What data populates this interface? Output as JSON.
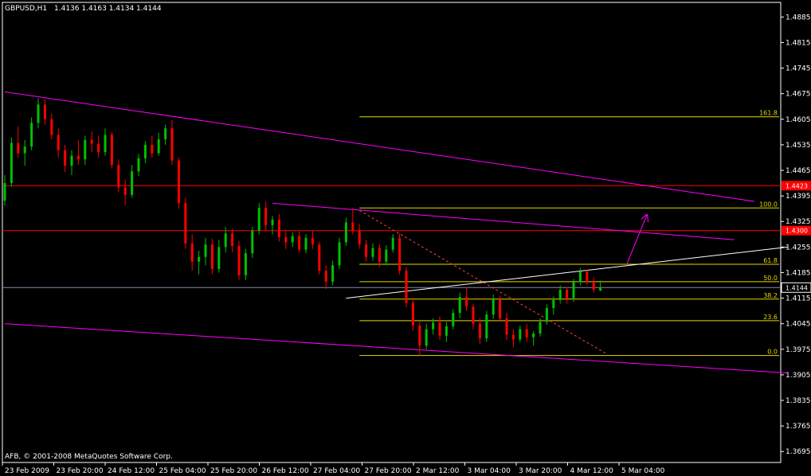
{
  "header": {
    "symbol": "GBPUSD,H1",
    "ohlc": "1.4136 1.4163 1.4134 1.4144"
  },
  "copyright": "AFB, © 2001-2008 MetaQuotes Software Corp.",
  "colors": {
    "background": "#000000",
    "bull_candle": "#00c000",
    "bear_candle": "#ff0000",
    "channel_line": "#ff00ff",
    "fib_line": "#e6d800",
    "level_line": "#ff0000",
    "trend_line": "#ffffff",
    "dashed_trend": "#ff4040",
    "grid_axis": "#ffffff"
  },
  "chart_data": {
    "type": "candlestick",
    "timeframe": "H1",
    "ylim": [
      1.3665,
      1.4925
    ],
    "y_ticks": [
      "1.4885",
      "1.4815",
      "1.4745",
      "1.4675",
      "1.4605",
      "1.4535",
      "1.4465",
      "1.4395",
      "1.4325",
      "1.4255",
      "1.4185",
      "1.4115",
      "1.4045",
      "1.3975",
      "1.3905",
      "1.3835",
      "1.3765",
      "1.3695"
    ],
    "x_ticks": [
      "23 Feb 2009",
      "23 Feb 20:00",
      "24 Feb 12:00",
      "25 Feb 04:00",
      "25 Feb 20:00",
      "26 Feb 12:00",
      "27 Feb 04:00",
      "27 Feb 20:00",
      "2 Mar 12:00",
      "3 Mar 04:00",
      "3 Mar 20:00",
      "4 Mar 12:00",
      "5 Mar 04:00"
    ],
    "current_price": "1.4144",
    "horizontal_levels": [
      {
        "price": "1.4423"
      },
      {
        "price": "1.4300"
      },
      {
        "price": "1.4144"
      }
    ],
    "fibonacci": {
      "price_low": 1.3958,
      "price_high": 1.4362,
      "levels": [
        {
          "label": "161.8",
          "ratio": 1.618
        },
        {
          "label": "100.0",
          "ratio": 1.0
        },
        {
          "label": "61.8",
          "ratio": 0.618
        },
        {
          "label": "50.0",
          "ratio": 0.5
        },
        {
          "label": "38.2",
          "ratio": 0.382
        },
        {
          "label": "23.6",
          "ratio": 0.236
        },
        {
          "label": "0.0",
          "ratio": 0.0
        }
      ]
    },
    "trend_lines": [
      {
        "kind": "channel",
        "from": [
          0,
          1.468
        ],
        "to": [
          112,
          1.438
        ]
      },
      {
        "kind": "channel",
        "from": [
          0,
          1.4045
        ],
        "to": [
          117,
          1.391
        ]
      },
      {
        "kind": "channel",
        "from": [
          40,
          1.4375
        ],
        "to": [
          109,
          1.4275
        ]
      },
      {
        "kind": "support",
        "from": [
          51,
          1.4115
        ],
        "to": [
          117,
          1.4255
        ]
      },
      {
        "kind": "dashed",
        "from": [
          53,
          1.4355
        ],
        "to": [
          90,
          1.3962
        ]
      },
      {
        "kind": "arrow",
        "from": [
          93,
          1.421
        ],
        "to": [
          96,
          1.4345
        ]
      }
    ],
    "candles": [
      [
        1.4382,
        1.4452,
        1.4368,
        1.443
      ],
      [
        1.443,
        1.4555,
        1.442,
        1.454
      ],
      [
        1.454,
        1.4585,
        1.45,
        1.4512
      ],
      [
        1.4512,
        1.4548,
        1.4478,
        1.453
      ],
      [
        1.453,
        1.461,
        1.452,
        1.4595
      ],
      [
        1.4595,
        1.4662,
        1.458,
        1.4645
      ],
      [
        1.4645,
        1.466,
        1.459,
        1.4605
      ],
      [
        1.4605,
        1.462,
        1.455,
        1.4562
      ],
      [
        1.4562,
        1.458,
        1.45,
        1.452
      ],
      [
        1.452,
        1.4535,
        1.446,
        1.4478
      ],
      [
        1.4478,
        1.452,
        1.4452,
        1.4505
      ],
      [
        1.4505,
        1.4548,
        1.448,
        1.4495
      ],
      [
        1.4495,
        1.456,
        1.448,
        1.4548
      ],
      [
        1.4548,
        1.4572,
        1.4515,
        1.4538
      ],
      [
        1.4538,
        1.456,
        1.45,
        1.4515
      ],
      [
        1.4515,
        1.458,
        1.4505,
        1.4562
      ],
      [
        1.4562,
        1.457,
        1.447,
        1.448
      ],
      [
        1.448,
        1.4495,
        1.4405,
        1.4418
      ],
      [
        1.4418,
        1.444,
        1.437,
        1.4398
      ],
      [
        1.4398,
        1.448,
        1.439,
        1.4462
      ],
      [
        1.4462,
        1.451,
        1.445,
        1.4498
      ],
      [
        1.4498,
        1.4545,
        1.4485,
        1.4535
      ],
      [
        1.4535,
        1.456,
        1.45,
        1.4512
      ],
      [
        1.4512,
        1.4568,
        1.4505,
        1.455
      ],
      [
        1.455,
        1.459,
        1.4535,
        1.458
      ],
      [
        1.458,
        1.4602,
        1.448,
        1.4492
      ],
      [
        1.4492,
        1.45,
        1.436,
        1.4375
      ],
      [
        1.4375,
        1.439,
        1.425,
        1.4265
      ],
      [
        1.4265,
        1.429,
        1.419,
        1.4215
      ],
      [
        1.4215,
        1.4245,
        1.418,
        1.4228
      ],
      [
        1.4228,
        1.428,
        1.4205,
        1.4262
      ],
      [
        1.4262,
        1.4278,
        1.418,
        1.4195
      ],
      [
        1.4195,
        1.4275,
        1.4185,
        1.4255
      ],
      [
        1.4255,
        1.431,
        1.424,
        1.4292
      ],
      [
        1.4292,
        1.4305,
        1.424,
        1.4258
      ],
      [
        1.4258,
        1.4272,
        1.4165,
        1.4178
      ],
      [
        1.4178,
        1.425,
        1.4165,
        1.4238
      ],
      [
        1.4238,
        1.431,
        1.4225,
        1.43
      ],
      [
        1.43,
        1.4375,
        1.429,
        1.4362
      ],
      [
        1.4362,
        1.438,
        1.43,
        1.4315
      ],
      [
        1.4315,
        1.434,
        1.429,
        1.433
      ],
      [
        1.433,
        1.4345,
        1.427,
        1.4282
      ],
      [
        1.4282,
        1.43,
        1.425,
        1.4268
      ],
      [
        1.4268,
        1.4295,
        1.4255,
        1.4285
      ],
      [
        1.4285,
        1.4298,
        1.424,
        1.4248
      ],
      [
        1.4248,
        1.429,
        1.4238,
        1.428
      ],
      [
        1.428,
        1.43,
        1.425,
        1.4262
      ],
      [
        1.4262,
        1.427,
        1.418,
        1.419
      ],
      [
        1.419,
        1.4205,
        1.414,
        1.416
      ],
      [
        1.416,
        1.4218,
        1.415,
        1.4205
      ],
      [
        1.4205,
        1.428,
        1.4195,
        1.4268
      ],
      [
        1.4268,
        1.4335,
        1.4258,
        1.4322
      ],
      [
        1.4322,
        1.4362,
        1.429,
        1.43
      ],
      [
        1.43,
        1.4318,
        1.425,
        1.4262
      ],
      [
        1.4262,
        1.4275,
        1.4215,
        1.4228
      ],
      [
        1.4228,
        1.4265,
        1.4218,
        1.4252
      ],
      [
        1.4252,
        1.4262,
        1.42,
        1.4215
      ],
      [
        1.4215,
        1.426,
        1.4205,
        1.4248
      ],
      [
        1.4248,
        1.429,
        1.424,
        1.428
      ],
      [
        1.428,
        1.4292,
        1.418,
        1.419
      ],
      [
        1.419,
        1.42,
        1.409,
        1.4102
      ],
      [
        1.4102,
        1.4115,
        1.4025,
        1.404
      ],
      [
        1.404,
        1.405,
        1.3958,
        1.3985
      ],
      [
        1.3985,
        1.4045,
        1.3975,
        1.403
      ],
      [
        1.403,
        1.406,
        1.4015,
        1.4048
      ],
      [
        1.4048,
        1.4065,
        1.4,
        1.4012
      ],
      [
        1.4012,
        1.405,
        1.3995,
        1.4038
      ],
      [
        1.4038,
        1.4085,
        1.403,
        1.4075
      ],
      [
        1.4075,
        1.413,
        1.406,
        1.4118
      ],
      [
        1.4118,
        1.4145,
        1.408,
        1.4092
      ],
      [
        1.4092,
        1.41,
        1.403,
        1.4045
      ],
      [
        1.4045,
        1.406,
        1.399,
        1.4005
      ],
      [
        1.4005,
        1.408,
        1.3995,
        1.407
      ],
      [
        1.407,
        1.4125,
        1.4058,
        1.4112
      ],
      [
        1.4112,
        1.412,
        1.405,
        1.406
      ],
      [
        1.406,
        1.4075,
        1.4,
        1.4015
      ],
      [
        1.4015,
        1.403,
        1.398,
        1.4002
      ],
      [
        1.4002,
        1.404,
        1.3995,
        1.403
      ],
      [
        1.403,
        1.4045,
        1.3995,
        1.4008
      ],
      [
        1.4008,
        1.4025,
        1.3985,
        1.4018
      ],
      [
        1.4018,
        1.406,
        1.401,
        1.405
      ],
      [
        1.405,
        1.4098,
        1.4042,
        1.4088
      ],
      [
        1.4088,
        1.412,
        1.407,
        1.411
      ],
      [
        1.411,
        1.415,
        1.41,
        1.4138
      ],
      [
        1.4138,
        1.4145,
        1.41,
        1.4115
      ],
      [
        1.4115,
        1.4168,
        1.4105,
        1.416
      ],
      [
        1.416,
        1.4198,
        1.415,
        1.4188
      ],
      [
        1.4188,
        1.4192,
        1.415,
        1.416
      ],
      [
        1.416,
        1.4172,
        1.413,
        1.4138
      ],
      [
        1.4136,
        1.4163,
        1.4134,
        1.4144
      ]
    ]
  }
}
